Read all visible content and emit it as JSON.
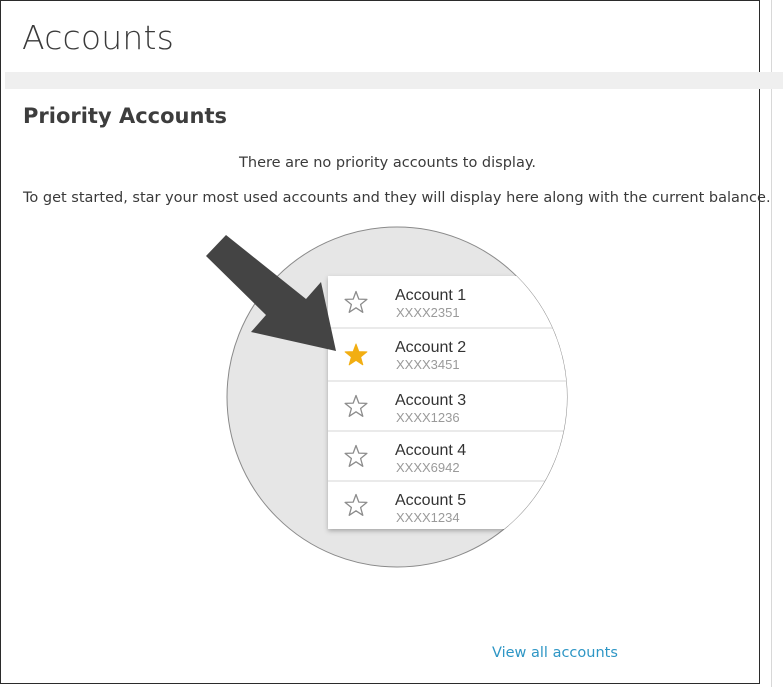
{
  "page": {
    "title": "Accounts"
  },
  "priority": {
    "heading": "Priority Accounts",
    "empty_message": "There are no priority accounts to display.",
    "help_text": "To get started, star your most used accounts and they will display here along with the current balance.",
    "view_all_label": "View all accounts"
  },
  "illustration": {
    "accounts": [
      {
        "name": "Account 1",
        "number": "XXXX2351",
        "starred": false,
        "icon": "star-outline-icon"
      },
      {
        "name": "Account 2",
        "number": "XXXX3451",
        "starred": true,
        "icon": "star-filled-icon"
      },
      {
        "name": "Account 3",
        "number": "XXXX1236",
        "starred": false,
        "icon": "star-outline-icon"
      },
      {
        "name": "Account 4",
        "number": "XXXX6942",
        "starred": false,
        "icon": "star-outline-icon"
      },
      {
        "name": "Account 5",
        "number": "XXXX1234",
        "starred": false,
        "icon": "star-outline-icon"
      }
    ],
    "arrow_icon": "arrow-pointer-icon"
  },
  "colors": {
    "link": "#2e96c5",
    "star_filled": "#f2ae12",
    "circle_fill": "#e6e6e6",
    "arrow": "#444444"
  }
}
